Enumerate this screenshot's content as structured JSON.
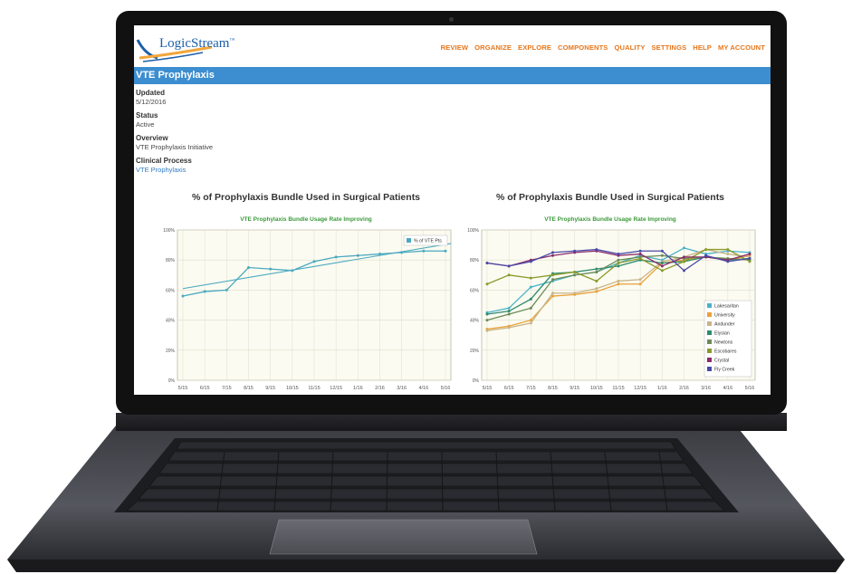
{
  "app": {
    "logo_text": "LogicStream",
    "logo_tm": "™"
  },
  "nav": {
    "items": [
      "REVIEW",
      "ORGANIZE",
      "EXPLORE",
      "COMPONENTS",
      "QUALITY",
      "SETTINGS",
      "HELP",
      "MY ACCOUNT"
    ]
  },
  "page": {
    "title": "VTE Prophylaxis",
    "updated_label": "Updated",
    "updated_value": "5/12/2016",
    "status_label": "Status",
    "status_value": "Active",
    "overview_label": "Overview",
    "overview_value": "VTE Prophylaxis Initiative",
    "clinical_label": "Clinical Process",
    "clinical_value": "VTE Prophylaxis"
  },
  "colors": {
    "nav": "#e8761b",
    "title_bar": "#3c8ed0",
    "subtitle": "#3a9a3a",
    "link": "#2f7cc4"
  },
  "chart_data": [
    {
      "type": "line",
      "title": "% of Prophylaxis Bundle Used in Surgical Patients",
      "subtitle": "VTE Prophylaxis Bundle Usage Rate Improving",
      "categories": [
        "5/15",
        "6/15",
        "7/15",
        "8/15",
        "9/15",
        "10/15",
        "11/15",
        "12/15",
        "1/16",
        "2/16",
        "3/16",
        "4/16",
        "5/16"
      ],
      "y_ticks": [
        "0%",
        "20%",
        "40%",
        "60%",
        "80%",
        "100%"
      ],
      "ylim": [
        0,
        100
      ],
      "grid": true,
      "legend_position": "top-right",
      "series": [
        {
          "name": "% of VTE Pts",
          "color": "#4aa9c0",
          "values": [
            56,
            59,
            60,
            75,
            74,
            73,
            79,
            82,
            83,
            84,
            85,
            86,
            86
          ]
        }
      ],
      "trendline": {
        "color": "#4aa9c0",
        "start": 61,
        "end": 91
      }
    },
    {
      "type": "line",
      "title": "% of Prophylaxis Bundle Used in Surgical Patients",
      "subtitle": "VTE Prophylaxis Bundle Usage Rate Improving",
      "categories": [
        "5/15",
        "6/15",
        "7/15",
        "8/15",
        "9/15",
        "10/15",
        "11/15",
        "12/15",
        "1/16",
        "2/16",
        "3/16",
        "4/16",
        "5/16"
      ],
      "y_ticks": [
        "0%",
        "20%",
        "40%",
        "60%",
        "80%",
        "100%"
      ],
      "ylim": [
        0,
        100
      ],
      "grid": true,
      "legend_position": "bottom-right",
      "series": [
        {
          "name": "Lakesaritan",
          "color": "#4ab2c8",
          "values": [
            45,
            48,
            62,
            66,
            70,
            72,
            78,
            83,
            80,
            88,
            84,
            86,
            85
          ]
        },
        {
          "name": "University",
          "color": "#e8a23a",
          "values": [
            34,
            36,
            40,
            56,
            57,
            59,
            64,
            64,
            78,
            80,
            82,
            80,
            83
          ]
        },
        {
          "name": "Andunder",
          "color": "#c9b48a",
          "values": [
            33,
            35,
            38,
            58,
            58,
            61,
            66,
            67,
            79,
            82,
            87,
            84,
            82
          ]
        },
        {
          "name": "Elysian",
          "color": "#2e8a6e",
          "values": [
            44,
            46,
            54,
            71,
            72,
            74,
            76,
            80,
            78,
            79,
            82,
            80,
            81
          ]
        },
        {
          "name": "Newtons",
          "color": "#6c8a55",
          "values": [
            40,
            44,
            48,
            67,
            70,
            72,
            80,
            82,
            83,
            81,
            82,
            81,
            80
          ]
        },
        {
          "name": "Escobares",
          "color": "#8a9a2a",
          "values": [
            64,
            70,
            68,
            70,
            72,
            66,
            78,
            81,
            73,
            79,
            87,
            87,
            79
          ]
        },
        {
          "name": "Crystal",
          "color": "#8a2a6a",
          "values": [
            78,
            76,
            80,
            83,
            85,
            86,
            83,
            84,
            76,
            82,
            82,
            80,
            84
          ]
        },
        {
          "name": "Fly Creek",
          "color": "#4a4aa8",
          "values": [
            78,
            76,
            79,
            85,
            86,
            87,
            84,
            86,
            86,
            73,
            83,
            79,
            81
          ]
        }
      ]
    }
  ]
}
